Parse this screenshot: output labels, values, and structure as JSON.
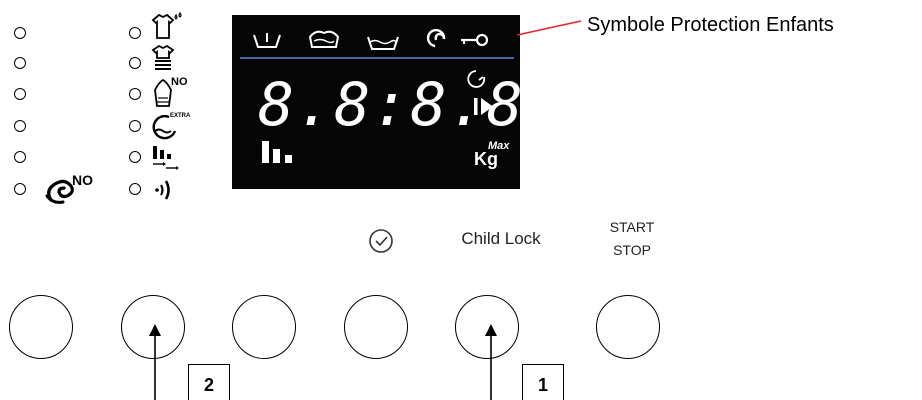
{
  "display": {
    "time_readout": "8.8:8.8.",
    "kg_label": "Kg",
    "max_label": "Max"
  },
  "callout": {
    "label": "Symbole Protection Enfants",
    "color": "#e3262d"
  },
  "options": {
    "no_spin_label": "NO",
    "no_iron_label": "NO",
    "extra_rinse_label": "EXTRA"
  },
  "buttons": {
    "delay_icon": "clock-icon",
    "child_lock_label": "Child Lock",
    "start_label": "START",
    "stop_label": "STOP"
  },
  "annotations": {
    "box1": "1",
    "box2": "2"
  }
}
